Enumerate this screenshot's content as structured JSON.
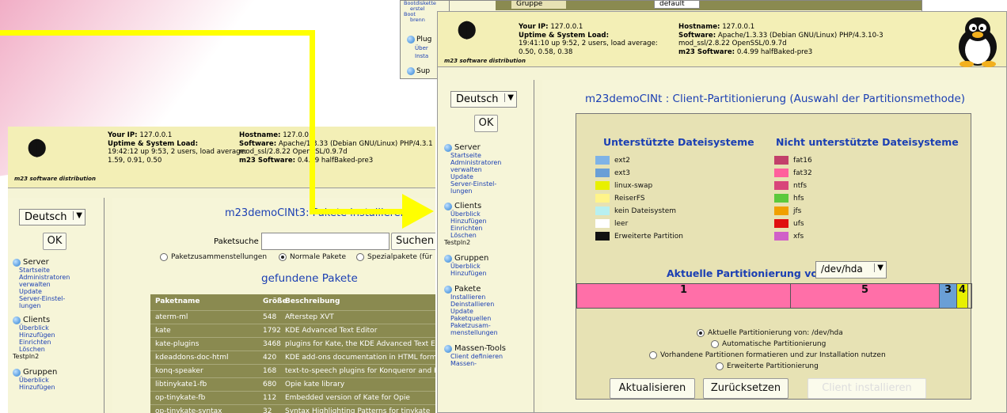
{
  "colors": {
    "accent": "#1b3fb3",
    "header": "#f3efb6",
    "panel": "#e7e2b4",
    "arrow": "#ffff00",
    "tableRow": "#8a8a50"
  },
  "top_window": {
    "sidebar_items": [
      "Bootdiskette",
      "erstel",
      "Boot",
      "brenn",
      "Plug",
      "Über",
      "Insta",
      "Sup"
    ],
    "form": {
      "label": "Gruppe",
      "value": "default"
    }
  },
  "logo_text": "m23 software distribution",
  "front": {
    "server": {
      "ip_label": "Your IP:",
      "ip": "127.0.0.1",
      "uptime_label": "Uptime & System Load:",
      "uptime": "19:41:10 up 9:52, 2 users, load average:",
      "load": "0.50, 0.58, 0.38",
      "host_label": "Hostname:",
      "host": "127.0.0.1",
      "sw_label": "Software:",
      "sw": "Apache/1.3.33 (Debian GNU/Linux) PHP/4.3.10-3",
      "ssl": "mod_ssl/2.8.22 OpenSSL/0.9.7d",
      "m23_label": "m23 Software:",
      "m23": "0.4.99 halfBaked-pre3"
    },
    "lang": "Deutsch",
    "ok": "OK",
    "nav": {
      "server": "Server",
      "startseite": "Startseite",
      "admin": "Administratoren",
      "admin2": "verwalten",
      "update": "Update",
      "einstel": "Server-Einstel-",
      "einstel2": "lungen",
      "clients": "Clients",
      "ueberblick": "Überblick",
      "hinzu": "Hinzufügen",
      "einrichten": "Einrichten",
      "loeschen": "Löschen",
      "testp": "Testpln2",
      "gruppen": "Gruppen",
      "g_ueberblick": "Überblick",
      "g_hinzu": "Hinzufügen",
      "pakete": "Pakete",
      "install": "Installieren",
      "deinstall": "Deinstallieren",
      "p_update": "Update",
      "quellen": "Paketquellen",
      "zusam": "Paketzusam-",
      "zusam2": "menstellungen",
      "massen": "Massen-Tools",
      "client_def": "Client definieren",
      "massen2": "Massen-"
    },
    "title": "m23demoCINt : Client-Partitionierung (Auswahl der Partitionsmethode)",
    "supported_title": "Unterstützte Dateisysteme",
    "unsupported_title": "Nicht unterstützte Dateisysteme",
    "supported": [
      {
        "name": "ext2",
        "color": "#7fb3e6"
      },
      {
        "name": "ext3",
        "color": "#6a9fd6"
      },
      {
        "name": "linux-swap",
        "color": "#e8f000"
      },
      {
        "name": "ReiserFS",
        "color": "#fff48a"
      },
      {
        "name": "kein Dateisystem",
        "color": "#b8f0f0"
      },
      {
        "name": "leer",
        "color": "#ffffff"
      },
      {
        "name": "Erweiterte Partition",
        "color": "#111111"
      }
    ],
    "unsupported": [
      {
        "name": "fat16",
        "color": "#c2406a"
      },
      {
        "name": "fat32",
        "color": "#ff5f9c"
      },
      {
        "name": "ntfs",
        "color": "#d8467a"
      },
      {
        "name": "hfs",
        "color": "#5cc93c"
      },
      {
        "name": "jfs",
        "color": "#f0a000"
      },
      {
        "name": "ufs",
        "color": "#e01010"
      },
      {
        "name": "xfs",
        "color": "#d060c8"
      }
    ],
    "current_label": "Aktuelle Partitionierung von:",
    "device": "/dev/hda",
    "partitions": [
      {
        "label": "1",
        "color": "#ff6fa8"
      },
      {
        "label": "5",
        "color": "#ff6fa8"
      },
      {
        "label": "3",
        "color": "#6a9fd6"
      },
      {
        "label": "4",
        "color": "#e8f000"
      }
    ],
    "options": [
      "Aktuelle Partitionierung von: /dev/hda",
      "Automatische Partitionierung",
      "Vorhandene Partitionen formatieren und zur Installation nutzen",
      "Erweiterte Partitionierung"
    ],
    "btn_refresh": "Aktualisieren",
    "btn_reset": "Zurücksetzen",
    "btn_disabled": "Client installieren"
  },
  "back": {
    "server": {
      "ip_label": "Your IP:",
      "ip": "127.0.0.1",
      "uptime_label": "Uptime & System Load:",
      "uptime": "19:42:12 up 9:53, 2 users, load average:",
      "load": "1.59, 0.91, 0.50",
      "host_label": "Hostname:",
      "host": "127.0.0.1",
      "sw_label": "Software:",
      "sw": "Apache/1.3.33 (Debian GNU/Linux) PHP/4.3.1",
      "ssl": "mod_ssl/2.8.22 OpenSSL/0.9.7d",
      "m23_label": "m23 Software:",
      "m23": "0.4.99 halfBaked-pre3"
    },
    "lang": "Deutsch",
    "ok": "OK",
    "nav": {
      "server": "Server",
      "startseite": "Startseite",
      "admin": "Administratoren",
      "admin2": "verwalten",
      "update": "Update",
      "einstel": "Server-Einstel-",
      "einstel2": "lungen",
      "clients": "Clients",
      "ueberblick": "Überblick",
      "hinzu": "Hinzufügen",
      "einrichten": "Einrichten",
      "loeschen": "Löschen",
      "testp": "Testpln2",
      "gruppen": "Gruppen",
      "g_ueberblick": "Überblick",
      "g_hinzu": "Hinzufügen"
    },
    "title": "m23demoCINt3: Pakete installieren",
    "search_label": "Paketsuche",
    "search_value": "",
    "search_btn": "Suchen",
    "radios": [
      "Paketzusammenstellungen",
      "Normale Pakete",
      "Spezialpakete (für"
    ],
    "found": "gefundene Pakete",
    "table": {
      "headers": [
        "Paketname",
        "Größe",
        "Beschreibung"
      ],
      "rows": [
        [
          "aterm-ml",
          "548",
          "Afterstep XVT"
        ],
        [
          "kate",
          "1792",
          "KDE Advanced Text Editor"
        ],
        [
          "kate-plugins",
          "3468",
          "plugins for Kate, the KDE Advanced Text E"
        ],
        [
          "kdeaddons-doc-html",
          "420",
          "KDE add-ons documentation in HTML form"
        ],
        [
          "konq-speaker",
          "168",
          "text-to-speech plugins for Konqueror and K"
        ],
        [
          "libtinykate1-fb",
          "680",
          "Opie kate library"
        ],
        [
          "op-tinykate-fb",
          "112",
          "Embedded version of Kate for Opie"
        ],
        [
          "op-tinykate-syntax",
          "32",
          "Syntax Highlighting Patterns for tinykate"
        ]
      ]
    }
  }
}
